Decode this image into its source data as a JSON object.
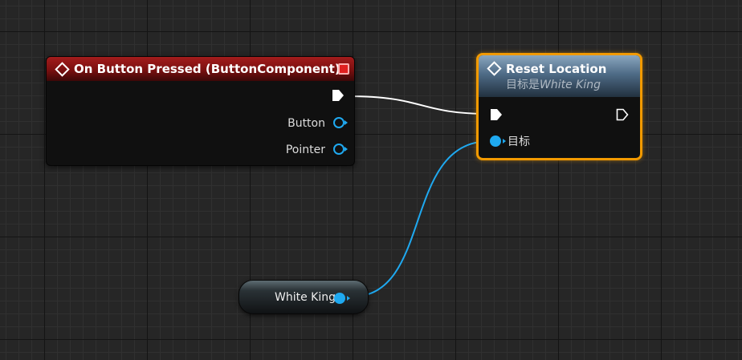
{
  "event_node": {
    "title": "On Button Pressed (ButtonComponent)",
    "header_color": "#8b1414",
    "icon": "event-diamond-icon",
    "pins": [
      {
        "label": "Button",
        "type": "object",
        "color": "#1fa9f0"
      },
      {
        "label": "Pointer",
        "type": "object",
        "color": "#1fa9f0"
      }
    ]
  },
  "function_node": {
    "title": "Reset Location",
    "subtitle_prefix": "目标是",
    "subtitle_target": "White King",
    "header_color": "#4e6b86",
    "selection_color": "#f29a00",
    "icon": "function-diamond-icon",
    "target_pin_label": "目标"
  },
  "variable_node": {
    "label": "White King",
    "pin_color": "#1fa9f0"
  },
  "colors": {
    "exec_wire": "#ffffff",
    "object_wire": "#1fa9f0",
    "grid_background": "#262626"
  }
}
